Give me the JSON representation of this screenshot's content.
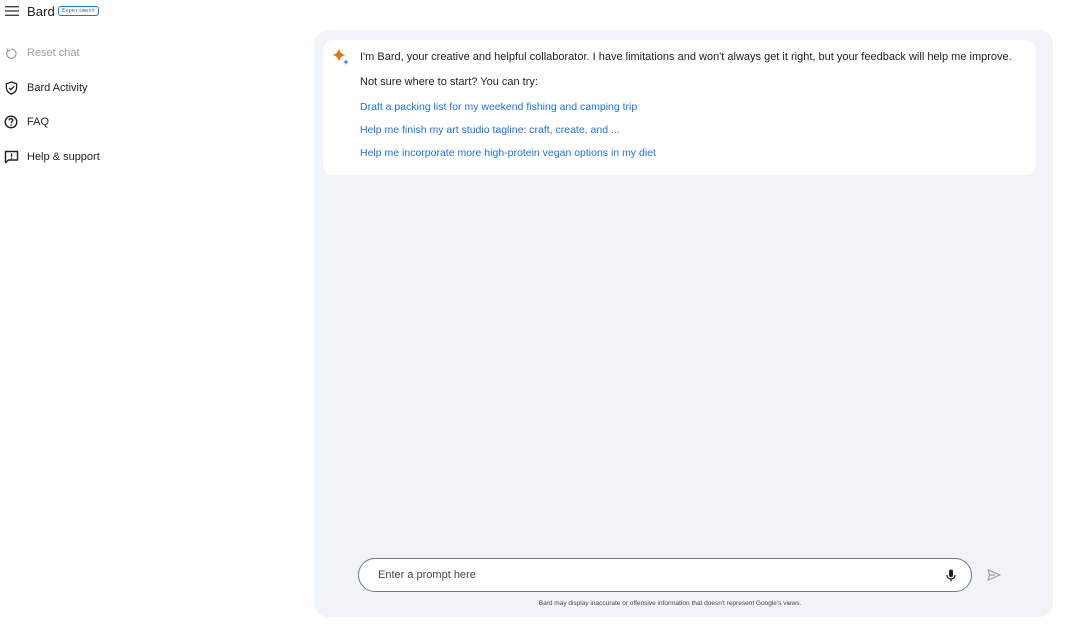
{
  "header": {
    "brand": "Bard",
    "badge": "Experiment"
  },
  "sidebar": {
    "items": [
      {
        "label": "Reset chat",
        "icon": "reset-icon",
        "enabled": false
      },
      {
        "label": "Bard Activity",
        "icon": "shield-icon",
        "enabled": true
      },
      {
        "label": "FAQ",
        "icon": "help-circle-icon",
        "enabled": true
      },
      {
        "label": "Help & support",
        "icon": "feedback-icon",
        "enabled": true
      }
    ]
  },
  "chat": {
    "intro": "I'm Bard, your creative and helpful collaborator. I have limitations and won't always get it right, but your feedback will help me improve.",
    "prompt_lead": "Not sure where to start? You can try:",
    "suggestions": [
      "Draft a packing list for my weekend fishing and camping trip",
      "Help me finish my art studio tagline: craft, create, and ...",
      "Help me incorporate more high-protein vegan options in my diet"
    ]
  },
  "input": {
    "placeholder": "Enter a prompt here",
    "value": ""
  },
  "disclaimer": "Bard may display inaccurate or offensive information that doesn't represent Google's views.",
  "colors": {
    "accent": "#1a73e8",
    "main_bg": "#f0f4f9",
    "spark_orange": "#e8710a",
    "spark_blue": "#4285f4"
  }
}
